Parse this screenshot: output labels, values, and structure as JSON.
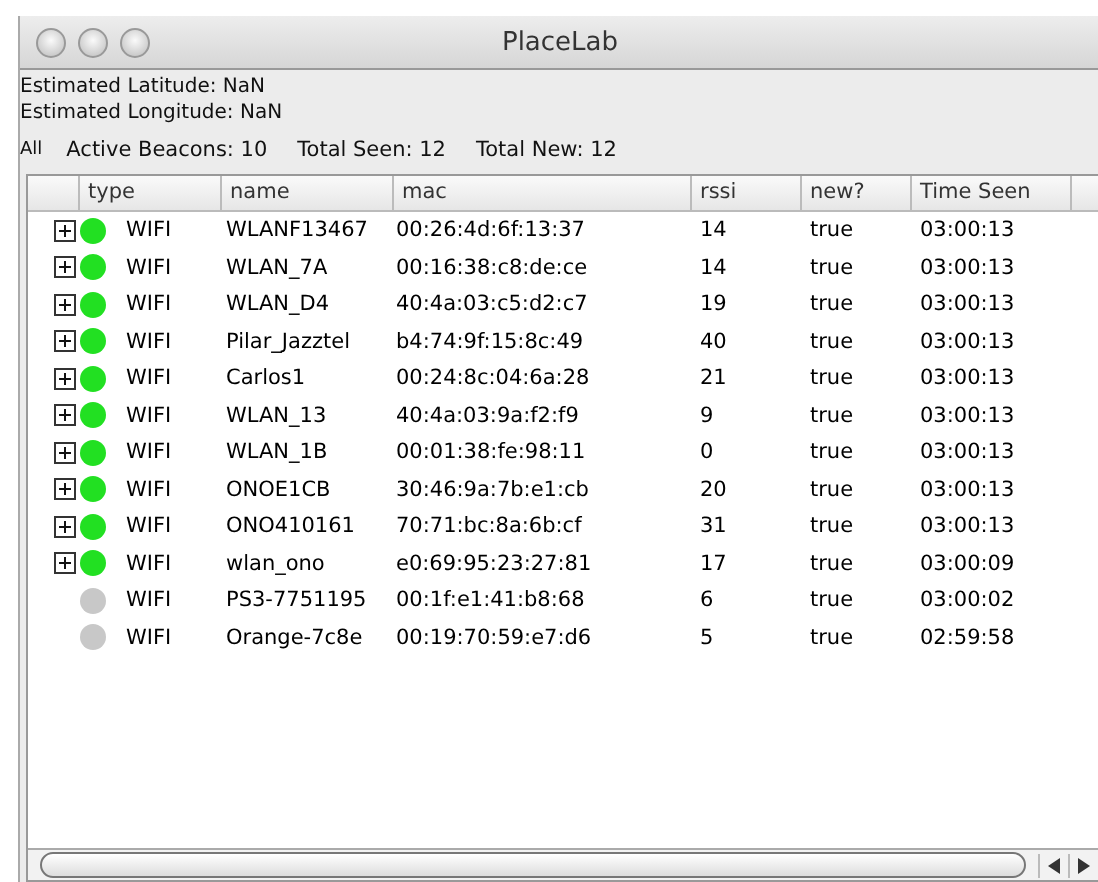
{
  "window": {
    "title": "PlaceLab"
  },
  "info": {
    "latitude": "Estimated Latitude: NaN",
    "longitude": "Estimated Longitude: NaN"
  },
  "stats": {
    "filter": "All",
    "active": "Active Beacons:  10",
    "seen": "Total Seen:  12",
    "new": "Total New: 12"
  },
  "table": {
    "columns": [
      "type",
      "name",
      "mac",
      "rssi",
      "new?",
      "Time Seen"
    ],
    "rows": [
      {
        "active": true,
        "type": "WIFI",
        "name": "WLANF13467",
        "mac": "00:26:4d:6f:13:37",
        "rssi": "14",
        "new": "true",
        "time": "03:00:13"
      },
      {
        "active": true,
        "type": "WIFI",
        "name": "WLAN_7A",
        "mac": "00:16:38:c8:de:ce",
        "rssi": "14",
        "new": "true",
        "time": "03:00:13"
      },
      {
        "active": true,
        "type": "WIFI",
        "name": "WLAN_D4",
        "mac": "40:4a:03:c5:d2:c7",
        "rssi": "19",
        "new": "true",
        "time": "03:00:13"
      },
      {
        "active": true,
        "type": "WIFI",
        "name": "Pilar_Jazztel",
        "mac": "b4:74:9f:15:8c:49",
        "rssi": "40",
        "new": "true",
        "time": "03:00:13"
      },
      {
        "active": true,
        "type": "WIFI",
        "name": "Carlos1",
        "mac": "00:24:8c:04:6a:28",
        "rssi": "21",
        "new": "true",
        "time": "03:00:13"
      },
      {
        "active": true,
        "type": "WIFI",
        "name": "WLAN_13",
        "mac": "40:4a:03:9a:f2:f9",
        "rssi": "9",
        "new": "true",
        "time": "03:00:13"
      },
      {
        "active": true,
        "type": "WIFI",
        "name": "WLAN_1B",
        "mac": "00:01:38:fe:98:11",
        "rssi": "0",
        "new": "true",
        "time": "03:00:13"
      },
      {
        "active": true,
        "type": "WIFI",
        "name": "ONOE1CB",
        "mac": "30:46:9a:7b:e1:cb",
        "rssi": "20",
        "new": "true",
        "time": "03:00:13"
      },
      {
        "active": true,
        "type": "WIFI",
        "name": "ONO410161",
        "mac": "70:71:bc:8a:6b:cf",
        "rssi": "31",
        "new": "true",
        "time": "03:00:13"
      },
      {
        "active": true,
        "type": "WIFI",
        "name": "wlan_ono",
        "mac": "e0:69:95:23:27:81",
        "rssi": "17",
        "new": "true",
        "time": "03:00:09"
      },
      {
        "active": false,
        "type": "WIFI",
        "name": "PS3-7751195",
        "mac": "00:1f:e1:41:b8:68",
        "rssi": "6",
        "new": "true",
        "time": "03:00:02"
      },
      {
        "active": false,
        "type": "WIFI",
        "name": "Orange-7c8e",
        "mac": "00:19:70:59:e7:d6",
        "rssi": "5",
        "new": "true",
        "time": "02:59:58"
      }
    ]
  }
}
